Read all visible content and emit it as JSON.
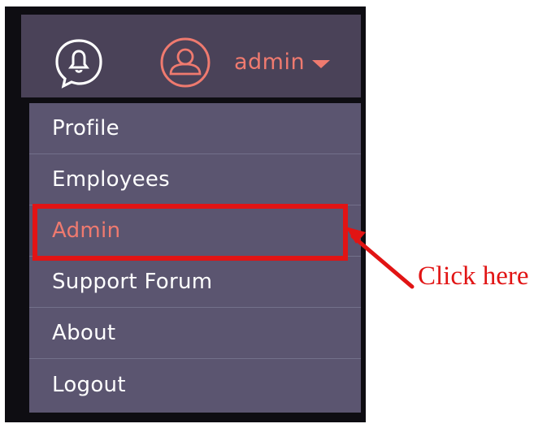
{
  "header": {
    "user_label": "admin",
    "icons": [
      "bell-icon",
      "user-icon",
      "caret-down-icon"
    ]
  },
  "menu": {
    "items": [
      {
        "label": "Profile",
        "active": false
      },
      {
        "label": "Employees",
        "active": false
      },
      {
        "label": "Admin",
        "active": true
      },
      {
        "label": "Support Forum",
        "active": false
      },
      {
        "label": "About",
        "active": false
      },
      {
        "label": "Logout",
        "active": false
      }
    ]
  },
  "annotation": {
    "text": "Click here",
    "color": "#e11414"
  },
  "colors": {
    "accent": "#ef7a6f",
    "header_bg": "#4a4258",
    "menu_bg": "#5b5570",
    "menu_text": "#ffffff"
  }
}
